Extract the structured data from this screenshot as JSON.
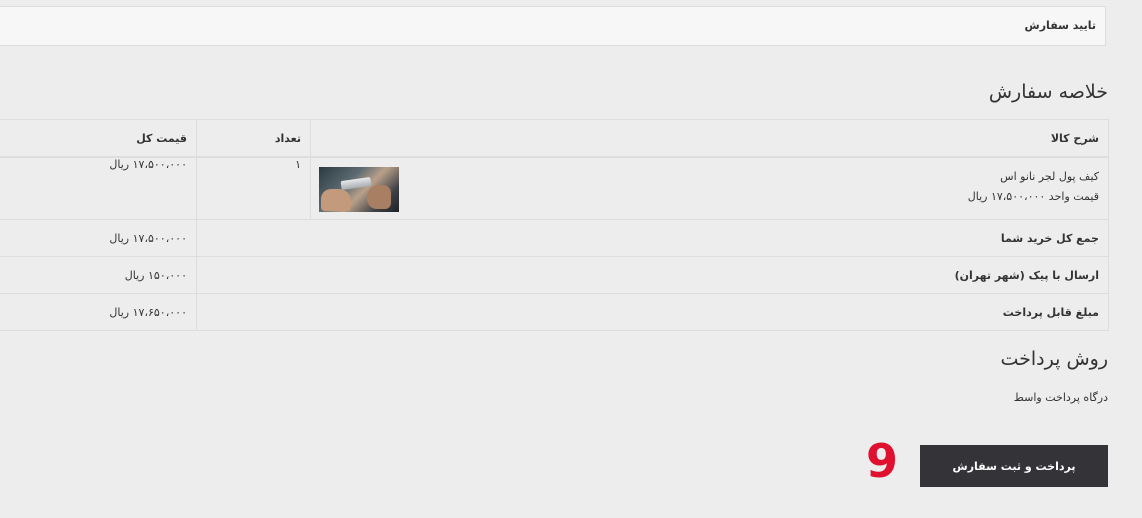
{
  "confirm_bar": {
    "title": "تایید سفارش"
  },
  "summary": {
    "heading": "خلاصه سفارش",
    "columns": {
      "description": "شرح کالا",
      "quantity": "تعداد",
      "total_price": "قیمت کل"
    },
    "items": [
      {
        "name": "کیف پول لجر نانو اس",
        "unit_price": "قیمت واحد ۱۷،۵۰۰،۰۰۰ ریال",
        "quantity": "۱",
        "total": "۱۷،۵۰۰،۰۰۰ ریال",
        "thumbnail_icon": "product-photo"
      }
    ],
    "rows": {
      "subtotal_label": "جمع کل خرید شما",
      "subtotal_value": "۱۷،۵۰۰،۰۰۰ ریال",
      "shipping_label": "ارسال با پیک (شهر تهران)",
      "shipping_value": "۱۵۰،۰۰۰ ریال",
      "payable_label": "مبلغ قابل پرداخت",
      "payable_value": "۱۷،۶۵۰،۰۰۰ ریال"
    }
  },
  "payment": {
    "heading": "روش پرداخت",
    "method": "درگاه پرداخت واسط",
    "submit_label": "پرداخت و ثبت سفارش"
  },
  "step_badge": "9",
  "colors": {
    "background": "#ededed",
    "button": "#333338",
    "badge": "#e0102f"
  }
}
